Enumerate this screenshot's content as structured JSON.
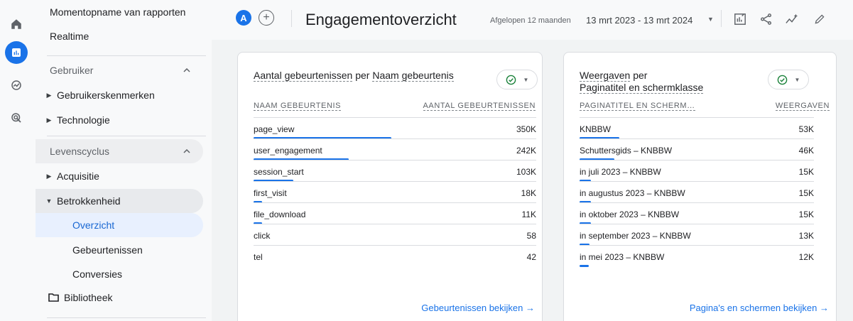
{
  "header": {
    "avatar_letter": "A",
    "add_symbol": "+",
    "title": "Engagementoverzicht",
    "date_label": "Afgelopen 12 maanden",
    "date_range": "13 mrt 2023 - 13 mrt 2024"
  },
  "sidebar": {
    "top_items": [
      "Momentopname van rapporten",
      "Realtime"
    ],
    "section_user": "Gebruiker",
    "user_items": [
      "Gebruikerskenmerken",
      "Technologie"
    ],
    "section_lifecycle": "Levenscyclus",
    "lifecycle_items": [
      "Acquisitie",
      "Betrokkenheid"
    ],
    "sub_items": [
      "Overzicht",
      "Gebeurtenissen",
      "Conversies"
    ],
    "library": "Bibliotheek"
  },
  "card1": {
    "title_a": "Aantal gebeurtenissen",
    "title_b": " per ",
    "title_c": "Naam gebeurtenis",
    "col_name": "NAAM GEBEURTENIS",
    "col_value": "AANTAL GEBEURTENISSEN",
    "rows": [
      {
        "name": "page_view",
        "value": "350K",
        "fraction": 1.0
      },
      {
        "name": "user_engagement",
        "value": "242K",
        "fraction": 0.69
      },
      {
        "name": "session_start",
        "value": "103K",
        "fraction": 0.29
      },
      {
        "name": "first_visit",
        "value": "18K",
        "fraction": 0.051
      },
      {
        "name": "file_download",
        "value": "11K",
        "fraction": 0.031
      },
      {
        "name": "click",
        "value": "58",
        "fraction": 0
      },
      {
        "name": "tel",
        "value": "42",
        "fraction": 0
      }
    ],
    "link": "Gebeurtenissen bekijken →"
  },
  "card2": {
    "title_a": "Weergaven",
    "title_b": " per",
    "title_c": "Paginatitel en schermklasse",
    "col_name": "PAGINATITEL EN SCHERM…",
    "col_value": "WEERGAVEN",
    "rows": [
      {
        "name": "KNBBW",
        "value": "53K",
        "fraction": 1.0
      },
      {
        "name": "Schuttersgids – KNBBW",
        "value": "46K",
        "fraction": 0.87
      },
      {
        "name": "in juli 2023 – KNBBW",
        "value": "15K",
        "fraction": 0.28
      },
      {
        "name": "in augustus 2023 – KNBBW",
        "value": "15K",
        "fraction": 0.28
      },
      {
        "name": "in oktober 2023 – KNBBW",
        "value": "15K",
        "fraction": 0.28
      },
      {
        "name": "in september 2023 – KNBBW",
        "value": "13K",
        "fraction": 0.25
      },
      {
        "name": "in mei 2023 – KNBBW",
        "value": "12K",
        "fraction": 0.23
      }
    ],
    "link": "Pagina's en schermen bekijken →"
  },
  "colors": {
    "accent": "#1a73e8",
    "check": "#188038"
  }
}
